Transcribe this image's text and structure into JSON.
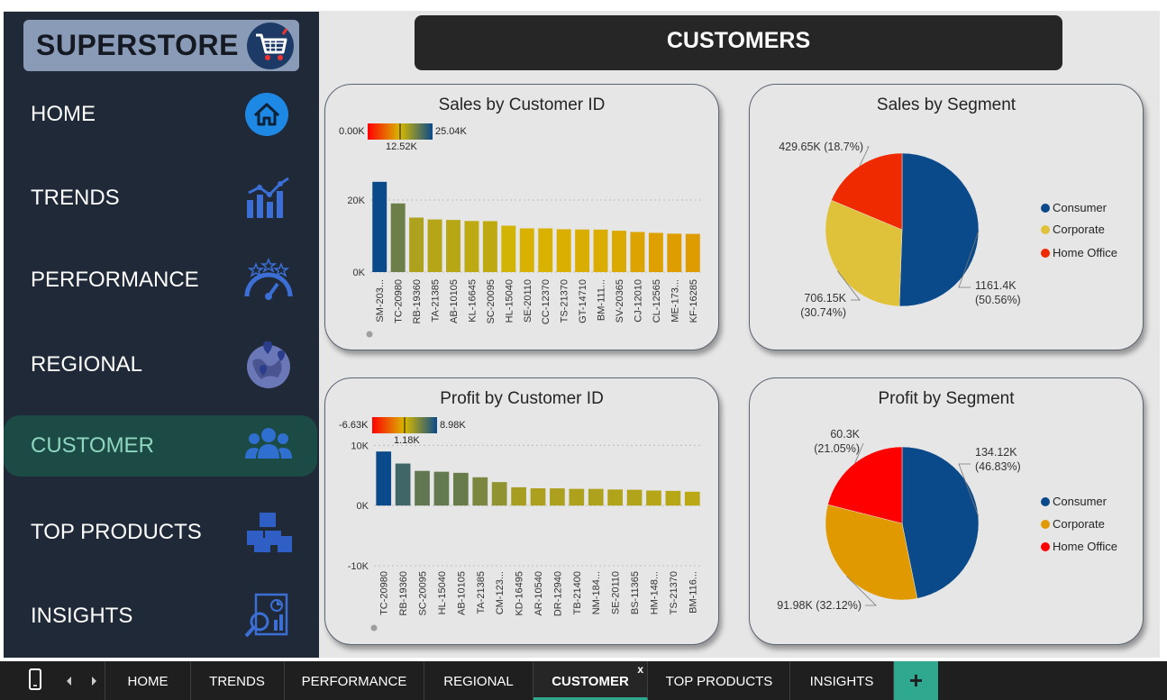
{
  "sidebar": {
    "logo_text": "SUPERSTORE",
    "items": [
      {
        "label": "HOME",
        "icon": "home-icon"
      },
      {
        "label": "TRENDS",
        "icon": "chart-bars-icon"
      },
      {
        "label": "PERFORMANCE",
        "icon": "gauge-icon"
      },
      {
        "label": "REGIONAL",
        "icon": "globe-map-icon"
      },
      {
        "label": "CUSTOMER",
        "icon": "people-icon"
      },
      {
        "label": "TOP PRODUCTS",
        "icon": "boxes-icon"
      },
      {
        "label": "INSIGHTS",
        "icon": "report-magnifier-icon"
      }
    ],
    "active": "CUSTOMER"
  },
  "header": {
    "title": "CUSTOMERS"
  },
  "colors": {
    "consumer": "#0b4a8a",
    "corporate_sales": "#e0c23a",
    "corporate_profit": "#e09a00",
    "home_office_sales": "#f02a00",
    "home_office_profit": "#ff0000",
    "sidebar_bg": "#1f2937",
    "accent": "#2ea98f"
  },
  "tabs": [
    "HOME",
    "TRENDS",
    "PERFORMANCE",
    "REGIONAL",
    "CUSTOMER",
    "TOP PRODUCTS",
    "INSIGHTS"
  ],
  "tab_close": "x",
  "tab_add": "+",
  "chart_data": [
    {
      "type": "bar",
      "title": "Sales by Customer ID",
      "color_scale": {
        "min_label": "0.00K",
        "mid_label": "12.52K",
        "max_label": "25.04K",
        "min": 0,
        "mid": 12.52,
        "max": 25.04
      },
      "categories": [
        "SM-203...",
        "TC-20980",
        "RB-19360",
        "TA-21385",
        "AB-10105",
        "KL-16645",
        "SC-20095",
        "HL-15040",
        "SE-20110",
        "CC-12370",
        "TS-21370",
        "GT-14710",
        "BM-111...",
        "SV-20365",
        "CJ-12010",
        "CL-12565",
        "ME-173...",
        "KF-16285"
      ],
      "values": [
        25.04,
        19.05,
        15.12,
        14.6,
        14.47,
        14.18,
        14.14,
        12.87,
        12.13,
        12.13,
        11.89,
        11.82,
        11.79,
        11.47,
        11.13,
        10.88,
        10.66,
        10.6
      ],
      "y_ticks": [
        "0K",
        "20K"
      ],
      "ylim": [
        0,
        28
      ]
    },
    {
      "type": "bar",
      "title": "Profit by Customer ID",
      "color_scale": {
        "min_label": "-6.63K",
        "mid_label": "1.18K",
        "max_label": "8.98K",
        "min": -6.63,
        "mid": 1.18,
        "max": 8.98
      },
      "categories": [
        "TC-20980",
        "RB-19360",
        "SC-20095",
        "HL-15040",
        "AB-10105",
        "TA-21385",
        "CM-123...",
        "KD-16495",
        "AR-10540",
        "DR-12940",
        "TB-21400",
        "NM-184...",
        "SE-20110",
        "BS-11365",
        "HM-148...",
        "TS-21370",
        "BM-116..."
      ],
      "values": [
        8.98,
        6.98,
        5.76,
        5.62,
        5.44,
        4.7,
        3.9,
        3.04,
        2.87,
        2.86,
        2.78,
        2.77,
        2.67,
        2.63,
        2.5,
        2.44,
        2.3
      ],
      "y_ticks": [
        "-10K",
        "0K",
        "10K"
      ],
      "ylim": [
        -10,
        12
      ]
    },
    {
      "type": "pie",
      "title": "Sales by Segment",
      "series": [
        {
          "name": "Consumer",
          "value": 1161.4,
          "label": "1161.4K\n(50.56%)"
        },
        {
          "name": "Corporate",
          "value": 706.15,
          "label": "706.15K\n(30.74%)"
        },
        {
          "name": "Home Office",
          "value": 429.65,
          "label": "429.65K (18.7%)"
        }
      ],
      "legend": [
        "Consumer",
        "Corporate",
        "Home Office"
      ]
    },
    {
      "type": "pie",
      "title": "Profit by Segment",
      "series": [
        {
          "name": "Consumer",
          "value": 134.12,
          "label": "134.12K\n(46.83%)"
        },
        {
          "name": "Corporate",
          "value": 91.98,
          "label": "91.98K (32.12%)"
        },
        {
          "name": "Home Office",
          "value": 60.3,
          "label": "60.3K\n(21.05%)"
        }
      ],
      "legend": [
        "Consumer",
        "Corporate",
        "Home Office"
      ]
    }
  ]
}
